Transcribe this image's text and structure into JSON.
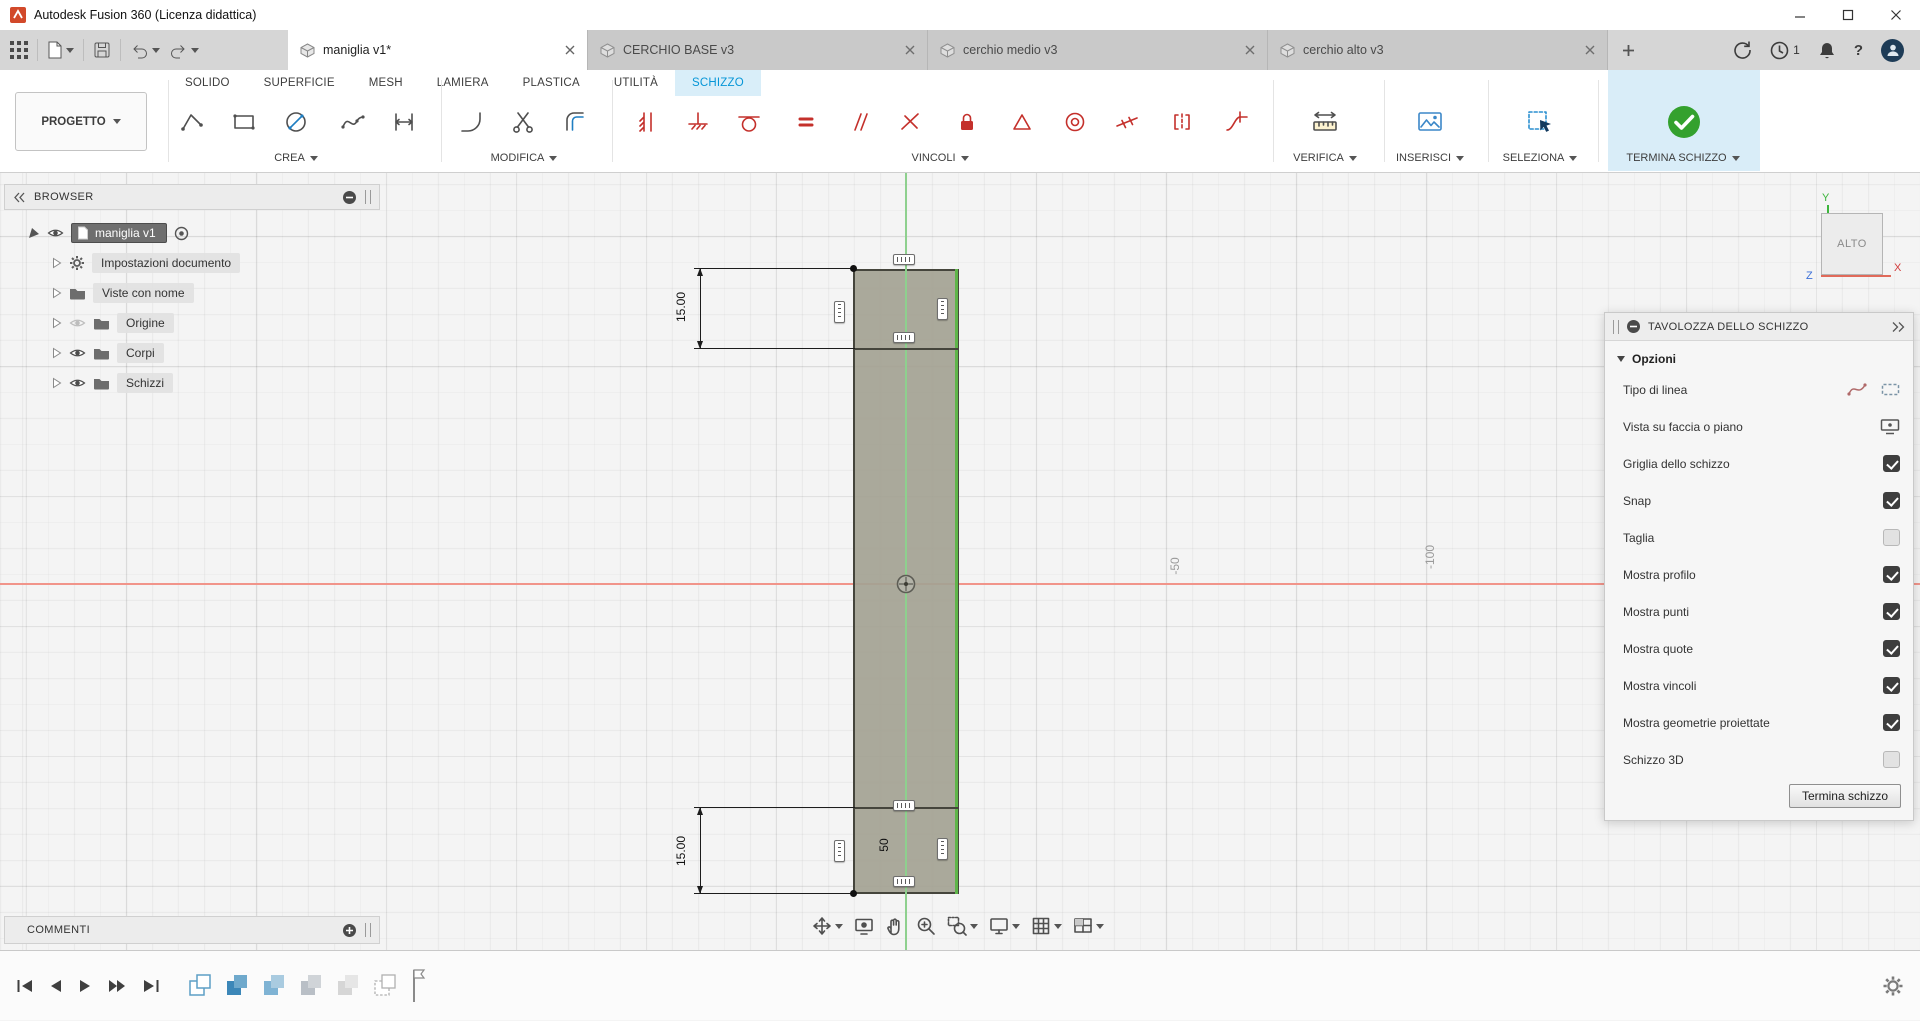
{
  "window": {
    "title": "Autodesk Fusion 360 (Licenza didattica)"
  },
  "icons": {
    "help": "?"
  },
  "tabbar": {
    "documents": [
      "maniglia v1*",
      "CERCHIO BASE v3",
      "cerchio medio v3",
      "cerchio alto v3"
    ],
    "job_count": "1"
  },
  "ribbon": {
    "project_label": "PROGETTO",
    "tabs": [
      "SOLIDO",
      "SUPERFICIE",
      "MESH",
      "LAMIERA",
      "PLASTICA",
      "UTILITÀ",
      "SCHIZZO"
    ],
    "active_tab": "SCHIZZO",
    "groups": {
      "crea": "CREA",
      "modifica": "MODIFICA",
      "vincoli": "VINCOLI",
      "verifica": "VERIFICA",
      "inserisci": "INSERISCI",
      "seleziona": "SELEZIONA",
      "termina": "TERMINA SCHIZZO"
    }
  },
  "browser": {
    "title": "BROWSER",
    "root_label": "maniglia v1",
    "items": [
      "Impostazioni documento",
      "Viste con nome",
      "Origine",
      "Corpi",
      "Schizzi"
    ]
  },
  "comments": {
    "title": "COMMENTI"
  },
  "canvas": {
    "viewcube_face": "ALTO",
    "axis_x_label": "X",
    "axis_y_label": "Y",
    "axis_z_label": "Z",
    "dim_top": "15.00",
    "dim_bottom": "15.00",
    "dim_width": "50",
    "grid_labels": [
      "-50",
      "-100"
    ]
  },
  "palette": {
    "title": "TAVOLOZZA DELLO SCHIZZO",
    "section_label": "Opzioni",
    "options": [
      {
        "label": "Tipo di linea"
      },
      {
        "label": "Vista su faccia o piano"
      },
      {
        "label": "Griglia dello schizzo",
        "checked": true
      },
      {
        "label": "Snap",
        "checked": true
      },
      {
        "label": "Taglia",
        "checked": false
      },
      {
        "label": "Mostra profilo",
        "checked": true
      },
      {
        "label": "Mostra punti",
        "checked": true
      },
      {
        "label": "Mostra quote",
        "checked": true
      },
      {
        "label": "Mostra vincoli",
        "checked": true
      },
      {
        "label": "Mostra geometrie proiettate",
        "checked": true
      },
      {
        "label": "Schizzo 3D",
        "checked": false
      }
    ],
    "finish_button": "Termina schizzo"
  },
  "colors": {
    "accent": "#0696d7",
    "constraint_red": "#c4302b",
    "axis_red": "#f1948a",
    "axis_green": "#8ed08e",
    "check_green": "#34a12e",
    "sketch_fill": "#a3a292"
  }
}
